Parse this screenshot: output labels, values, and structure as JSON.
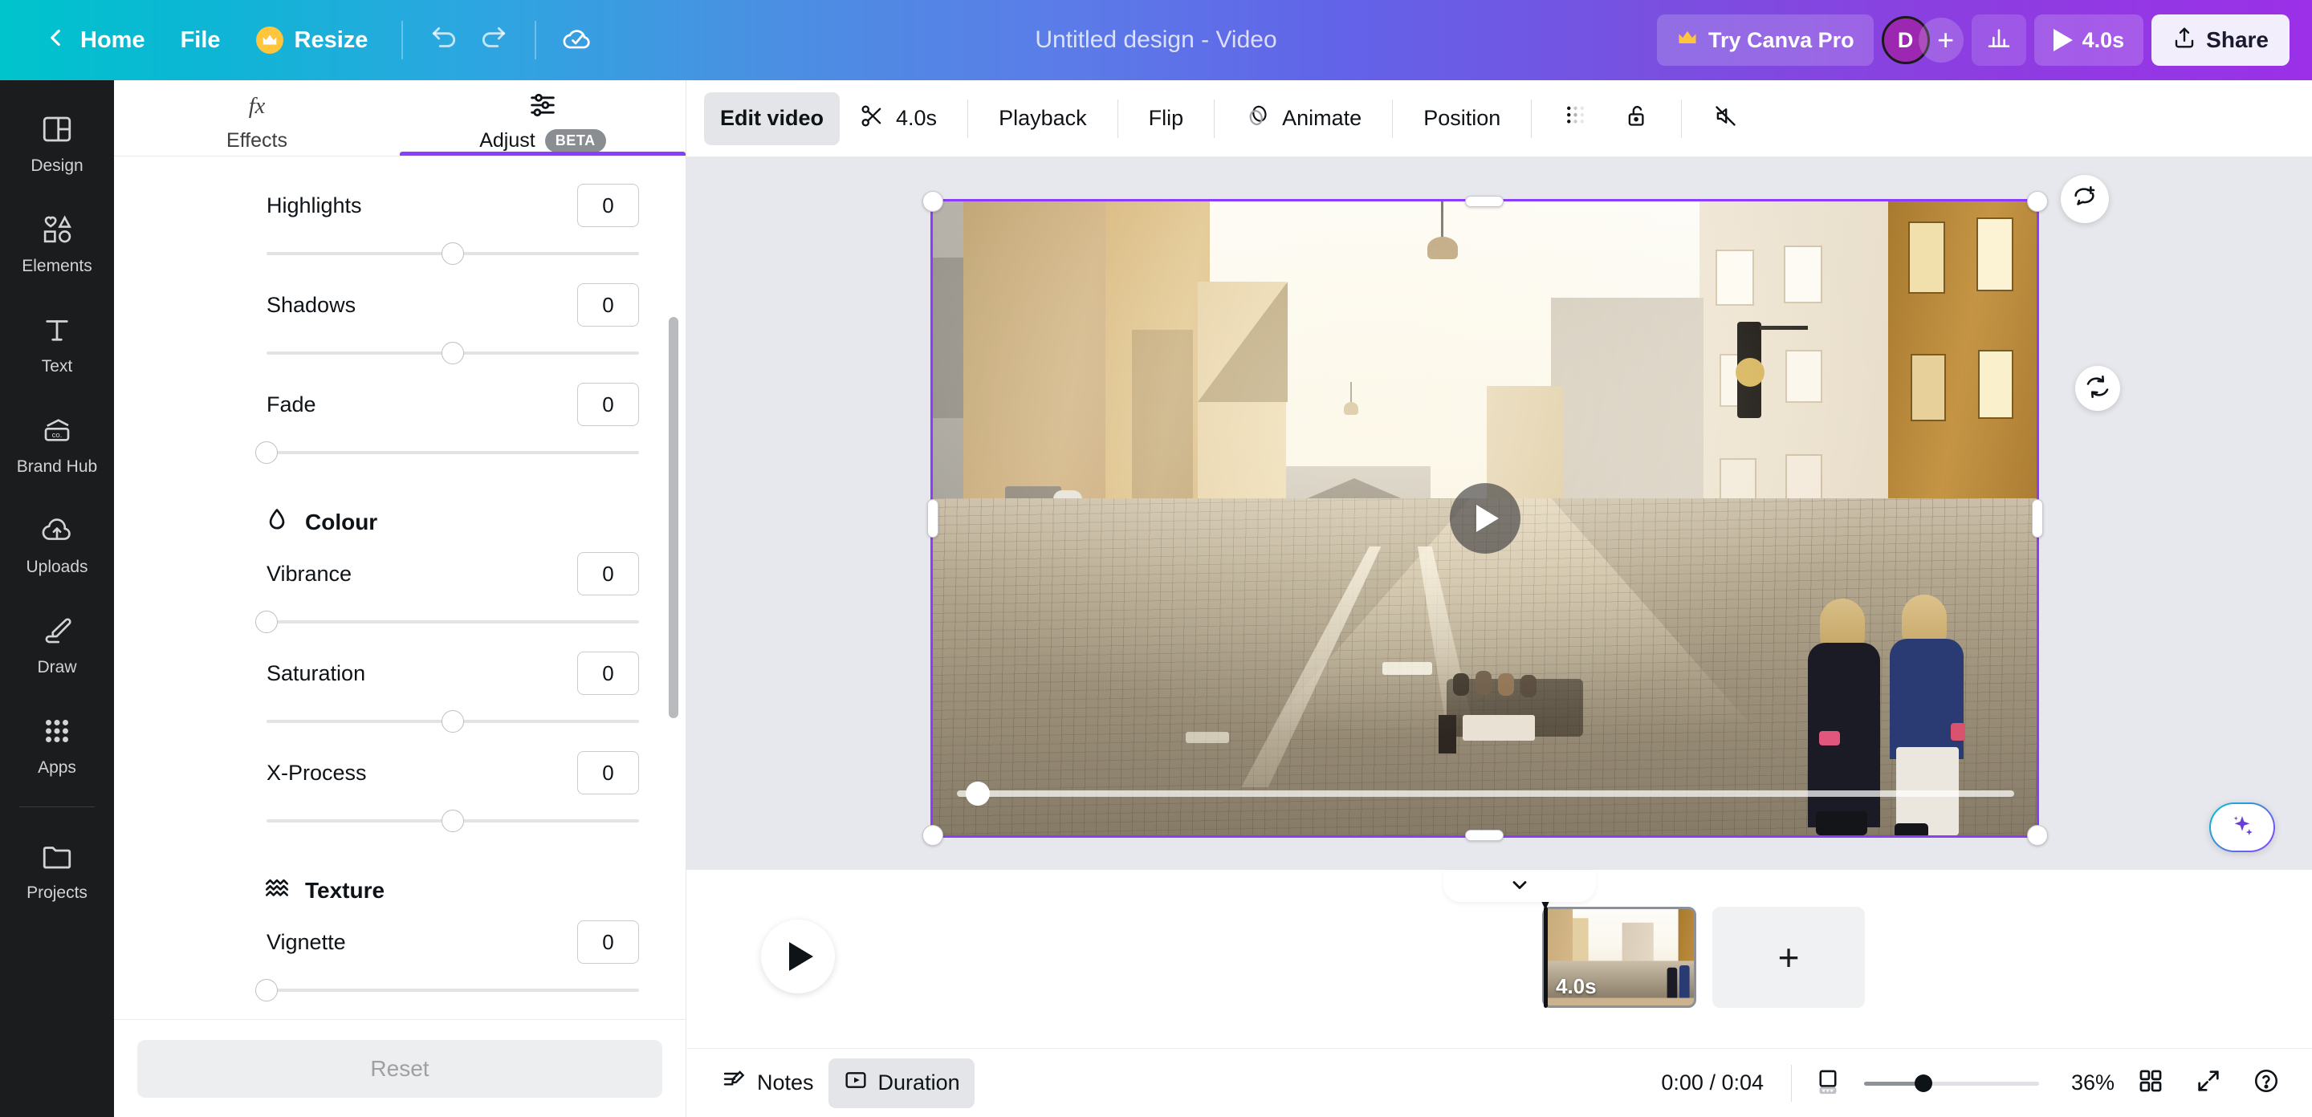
{
  "topbar": {
    "back_icon": "chevron-left-icon",
    "home_label": "Home",
    "file_label": "File",
    "resize_label": "Resize",
    "resize_icon": "crown-icon",
    "undo_icon": "undo-icon",
    "redo_icon": "redo-icon",
    "saved_icon": "cloud-check-icon",
    "design_title": "Untitled design - Video",
    "try_pro_label": "Try Canva Pro",
    "try_pro_icon": "crown-icon",
    "avatar_initial": "D",
    "add_collaborator_icon": "plus-icon",
    "insights_icon": "bar-chart-icon",
    "present_label": "4.0s",
    "present_icon": "play-icon",
    "share_label": "Share",
    "share_icon": "upload-icon",
    "accent": "#8b3dff"
  },
  "rail": {
    "items": [
      {
        "label": "Design",
        "icon": "layout-icon"
      },
      {
        "label": "Elements",
        "icon": "shapes-icon"
      },
      {
        "label": "Text",
        "icon": "text-t-icon"
      },
      {
        "label": "Brand Hub",
        "icon": "brand-card-icon"
      },
      {
        "label": "Uploads",
        "icon": "cloud-upload-icon"
      },
      {
        "label": "Draw",
        "icon": "pen-icon"
      },
      {
        "label": "Apps",
        "icon": "grid-dots-icon"
      }
    ],
    "footer_items": [
      {
        "label": "Projects",
        "icon": "folder-icon"
      }
    ]
  },
  "panel": {
    "tabs": [
      {
        "label": "Effects",
        "icon": "fx-icon",
        "active": false,
        "badge": ""
      },
      {
        "label": "Adjust",
        "icon": "sliders-icon",
        "active": true,
        "badge": "BETA"
      }
    ],
    "groups": [
      {
        "title": "",
        "icon": "",
        "rows": [
          {
            "label": "Highlights",
            "value": "0",
            "knob_pct": 50
          },
          {
            "label": "Shadows",
            "value": "0",
            "knob_pct": 50
          },
          {
            "label": "Fade",
            "value": "0",
            "knob_pct": 0
          }
        ]
      },
      {
        "title": "Colour",
        "icon": "droplet-icon",
        "rows": [
          {
            "label": "Vibrance",
            "value": "0",
            "knob_pct": 0
          },
          {
            "label": "Saturation",
            "value": "0",
            "knob_pct": 50
          },
          {
            "label": "X-Process",
            "value": "0",
            "knob_pct": 50
          }
        ]
      },
      {
        "title": "Texture",
        "icon": "waves-icon",
        "rows": [
          {
            "label": "Vignette",
            "value": "0",
            "knob_pct": 0
          }
        ]
      }
    ],
    "reset_label": "Reset"
  },
  "editor_toolbar": {
    "edit_video_label": "Edit video",
    "duration_label": "4.0s",
    "duration_icon": "scissors-icon",
    "playback_label": "Playback",
    "flip_label": "Flip",
    "animate_label": "Animate",
    "animate_icon": "animate-icon",
    "position_label": "Position",
    "transparency_icon": "transparency-icon",
    "lock_icon": "lock-open-icon",
    "mute_icon": "speaker-mute-icon"
  },
  "canvas": {
    "play_icon": "play-icon",
    "comment_icon": "comment-add-icon",
    "rotate_icon": "rotate-icon",
    "magic_icon": "magic-sparkle-icon",
    "scrub_position_pct": 2
  },
  "timeline": {
    "play_icon": "play-icon",
    "clip_duration": "4.0s",
    "add_page_icon": "plus-icon",
    "collapse_icon": "chevron-down-icon"
  },
  "bottombar": {
    "notes_label": "Notes",
    "notes_icon": "notes-icon",
    "duration_label": "Duration",
    "duration_icon": "duration-icon",
    "time_display": "0:00 / 0:04",
    "pages_icon": "page-view-icon",
    "zoom_pct": "36%",
    "zoom_value": 36,
    "grid_icon": "grid-view-icon",
    "fullscreen_icon": "expand-icon",
    "help_icon": "help-icon"
  }
}
